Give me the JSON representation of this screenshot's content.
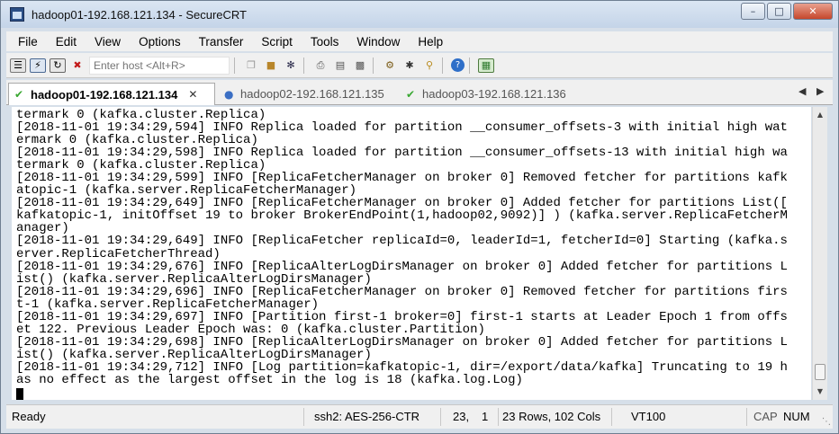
{
  "window": {
    "title": "hadoop01-192.168.121.134 - SecureCRT",
    "controls": {
      "minimize": "–",
      "maximize": "□",
      "close": "✕"
    }
  },
  "menu": [
    {
      "label": "File"
    },
    {
      "label": "Edit"
    },
    {
      "label": "View"
    },
    {
      "label": "Options"
    },
    {
      "label": "Transfer"
    },
    {
      "label": "Script"
    },
    {
      "label": "Tools"
    },
    {
      "label": "Window"
    },
    {
      "label": "Help"
    }
  ],
  "toolbar": {
    "host_placeholder": "Enter host <Alt+R>",
    "icons": [
      "connect-icon",
      "quick-connect-icon",
      "reconnect-icon",
      "disconnect-icon",
      "copy-icon",
      "paste-icon",
      "find-icon",
      "print-icon",
      "print-setup-icon",
      "printer-icon",
      "session-options-icon",
      "global-options-icon",
      "keymap-icon",
      "help-icon",
      "sftp-icon"
    ]
  },
  "tabs": [
    {
      "label": "hadoop01-192.168.121.134",
      "active": true,
      "status": "connected",
      "status_color": "#3aa832"
    },
    {
      "label": "hadoop02-192.168.121.135",
      "active": false,
      "status": "info",
      "status_color": "#3b6fc4"
    },
    {
      "label": "hadoop03-192.168.121.136",
      "active": false,
      "status": "connected",
      "status_color": "#3aa832"
    }
  ],
  "terminal": {
    "lines": [
      "termark 0 (kafka.cluster.Replica)",
      "[2018-11-01 19:34:29,594] INFO Replica loaded for partition __consumer_offsets-3 with initial high wat",
      "ermark 0 (kafka.cluster.Replica)",
      "[2018-11-01 19:34:29,598] INFO Replica loaded for partition __consumer_offsets-13 with initial high wa",
      "termark 0 (kafka.cluster.Replica)",
      "[2018-11-01 19:34:29,599] INFO [ReplicaFetcherManager on broker 0] Removed fetcher for partitions kafk",
      "atopic-1 (kafka.server.ReplicaFetcherManager)",
      "[2018-11-01 19:34:29,649] INFO [ReplicaFetcherManager on broker 0] Added fetcher for partitions List([",
      "kafkatopic-1, initOffset 19 to broker BrokerEndPoint(1,hadoop02,9092)] ) (kafka.server.ReplicaFetcherM",
      "anager)",
      "[2018-11-01 19:34:29,649] INFO [ReplicaFetcher replicaId=0, leaderId=1, fetcherId=0] Starting (kafka.s",
      "erver.ReplicaFetcherThread)",
      "[2018-11-01 19:34:29,676] INFO [ReplicaAlterLogDirsManager on broker 0] Added fetcher for partitions L",
      "ist() (kafka.server.ReplicaAlterLogDirsManager)",
      "[2018-11-01 19:34:29,696] INFO [ReplicaFetcherManager on broker 0] Removed fetcher for partitions firs",
      "t-1 (kafka.server.ReplicaFetcherManager)",
      "[2018-11-01 19:34:29,697] INFO [Partition first-1 broker=0] first-1 starts at Leader Epoch 1 from offs",
      "et 122. Previous Leader Epoch was: 0 (kafka.cluster.Partition)",
      "[2018-11-01 19:34:29,698] INFO [ReplicaAlterLogDirsManager on broker 0] Added fetcher for partitions L",
      "ist() (kafka.server.ReplicaAlterLogDirsManager)",
      "[2018-11-01 19:34:29,712] INFO [Log partition=kafkatopic-1, dir=/export/data/kafka] Truncating to 19 h",
      "as no effect as the largest offset in the log is 18 (kafka.log.Log)"
    ]
  },
  "statusbar": {
    "state": "Ready",
    "cipher": "ssh2: AES-256-CTR",
    "row": "23,",
    "col": "1",
    "size": "23 Rows, 102 Cols",
    "emulation": "VT100",
    "caps": "CAP",
    "num": "NUM"
  }
}
